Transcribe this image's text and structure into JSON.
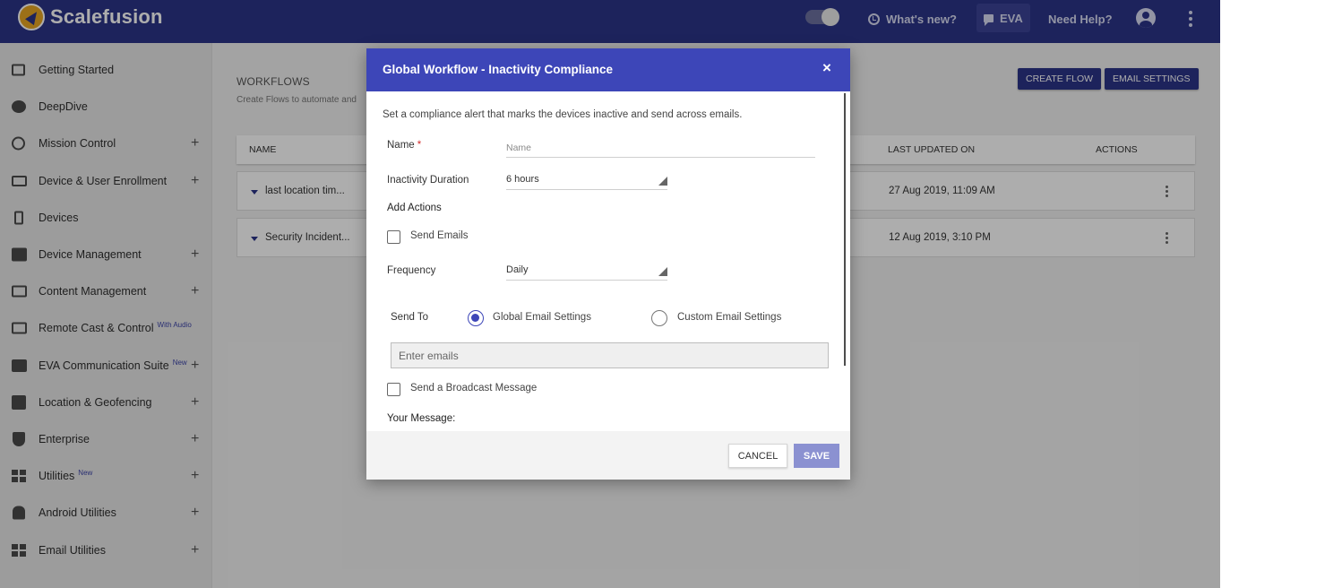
{
  "app": {
    "logo_text": "Scalefusion"
  },
  "topbar": {
    "whats_new": "What's new?",
    "eva": "EVA",
    "need_help": "Need Help?"
  },
  "sidebar": {
    "items": [
      {
        "label": "Getting Started",
        "sup": "",
        "expand": false,
        "icon": "enter-icon"
      },
      {
        "label": "DeepDive",
        "sup": "",
        "expand": false,
        "icon": "gauge-icon"
      },
      {
        "label": "Mission Control",
        "sup": "",
        "expand": true,
        "icon": "control-icon"
      },
      {
        "label": "Device & User Enrollment",
        "sup": "",
        "expand": true,
        "icon": "devices-icon"
      },
      {
        "label": "Devices",
        "sup": "",
        "expand": false,
        "icon": "phone-icon"
      },
      {
        "label": "Device Management",
        "sup": "",
        "expand": true,
        "icon": "briefcase-icon"
      },
      {
        "label": "Content Management",
        "sup": "",
        "expand": true,
        "icon": "folder-icon"
      },
      {
        "label": "Remote Cast & Control",
        "sup": "With Audio",
        "expand": false,
        "icon": "cast-icon"
      },
      {
        "label": "EVA Communication Suite",
        "sup": "New",
        "expand": true,
        "icon": "message-icon"
      },
      {
        "label": "Location & Geofencing",
        "sup": "",
        "expand": true,
        "icon": "map-icon"
      },
      {
        "label": "Enterprise",
        "sup": "",
        "expand": true,
        "icon": "shield-icon"
      },
      {
        "label": "Utilities",
        "sup": "New",
        "expand": true,
        "icon": "widgets-icon"
      },
      {
        "label": "Android Utilities",
        "sup": "",
        "expand": true,
        "icon": "android-icon"
      },
      {
        "label": "Email Utilities",
        "sup": "",
        "expand": true,
        "icon": "widgets-icon"
      }
    ],
    "plus": "+"
  },
  "main": {
    "title": "WORKFLOWS",
    "subtitle": "Create Flows to automate and",
    "create_flow": "CREATE FLOW",
    "email_settings": "EMAIL SETTINGS",
    "columns": {
      "name": "NAME",
      "last_updated": "LAST UPDATED ON",
      "actions": "ACTIONS"
    },
    "rows": [
      {
        "name": "last location tim...",
        "updated": "27 Aug 2019, 11:09 AM"
      },
      {
        "name": "Security Incident...",
        "updated": "12 Aug 2019, 3:10 PM"
      }
    ]
  },
  "modal": {
    "title": "Global Workflow - Inactivity Compliance",
    "close": "×",
    "description": "Set a compliance alert that marks the devices inactive and send across emails.",
    "name_label": "Name",
    "required_mark": "*",
    "name_placeholder": "Name",
    "inactivity_label": "Inactivity Duration",
    "inactivity_value": "6 hours",
    "add_actions": "Add Actions",
    "send_emails": "Send Emails",
    "frequency_label": "Frequency",
    "frequency_value": "Daily",
    "send_to_label": "Send To",
    "global_email": "Global Email Settings",
    "custom_email": "Custom Email Settings",
    "emails_placeholder": "Enter emails",
    "broadcast": "Send a Broadcast Message",
    "your_message": "Your Message:",
    "cancel": "CANCEL",
    "save": "SAVE"
  }
}
